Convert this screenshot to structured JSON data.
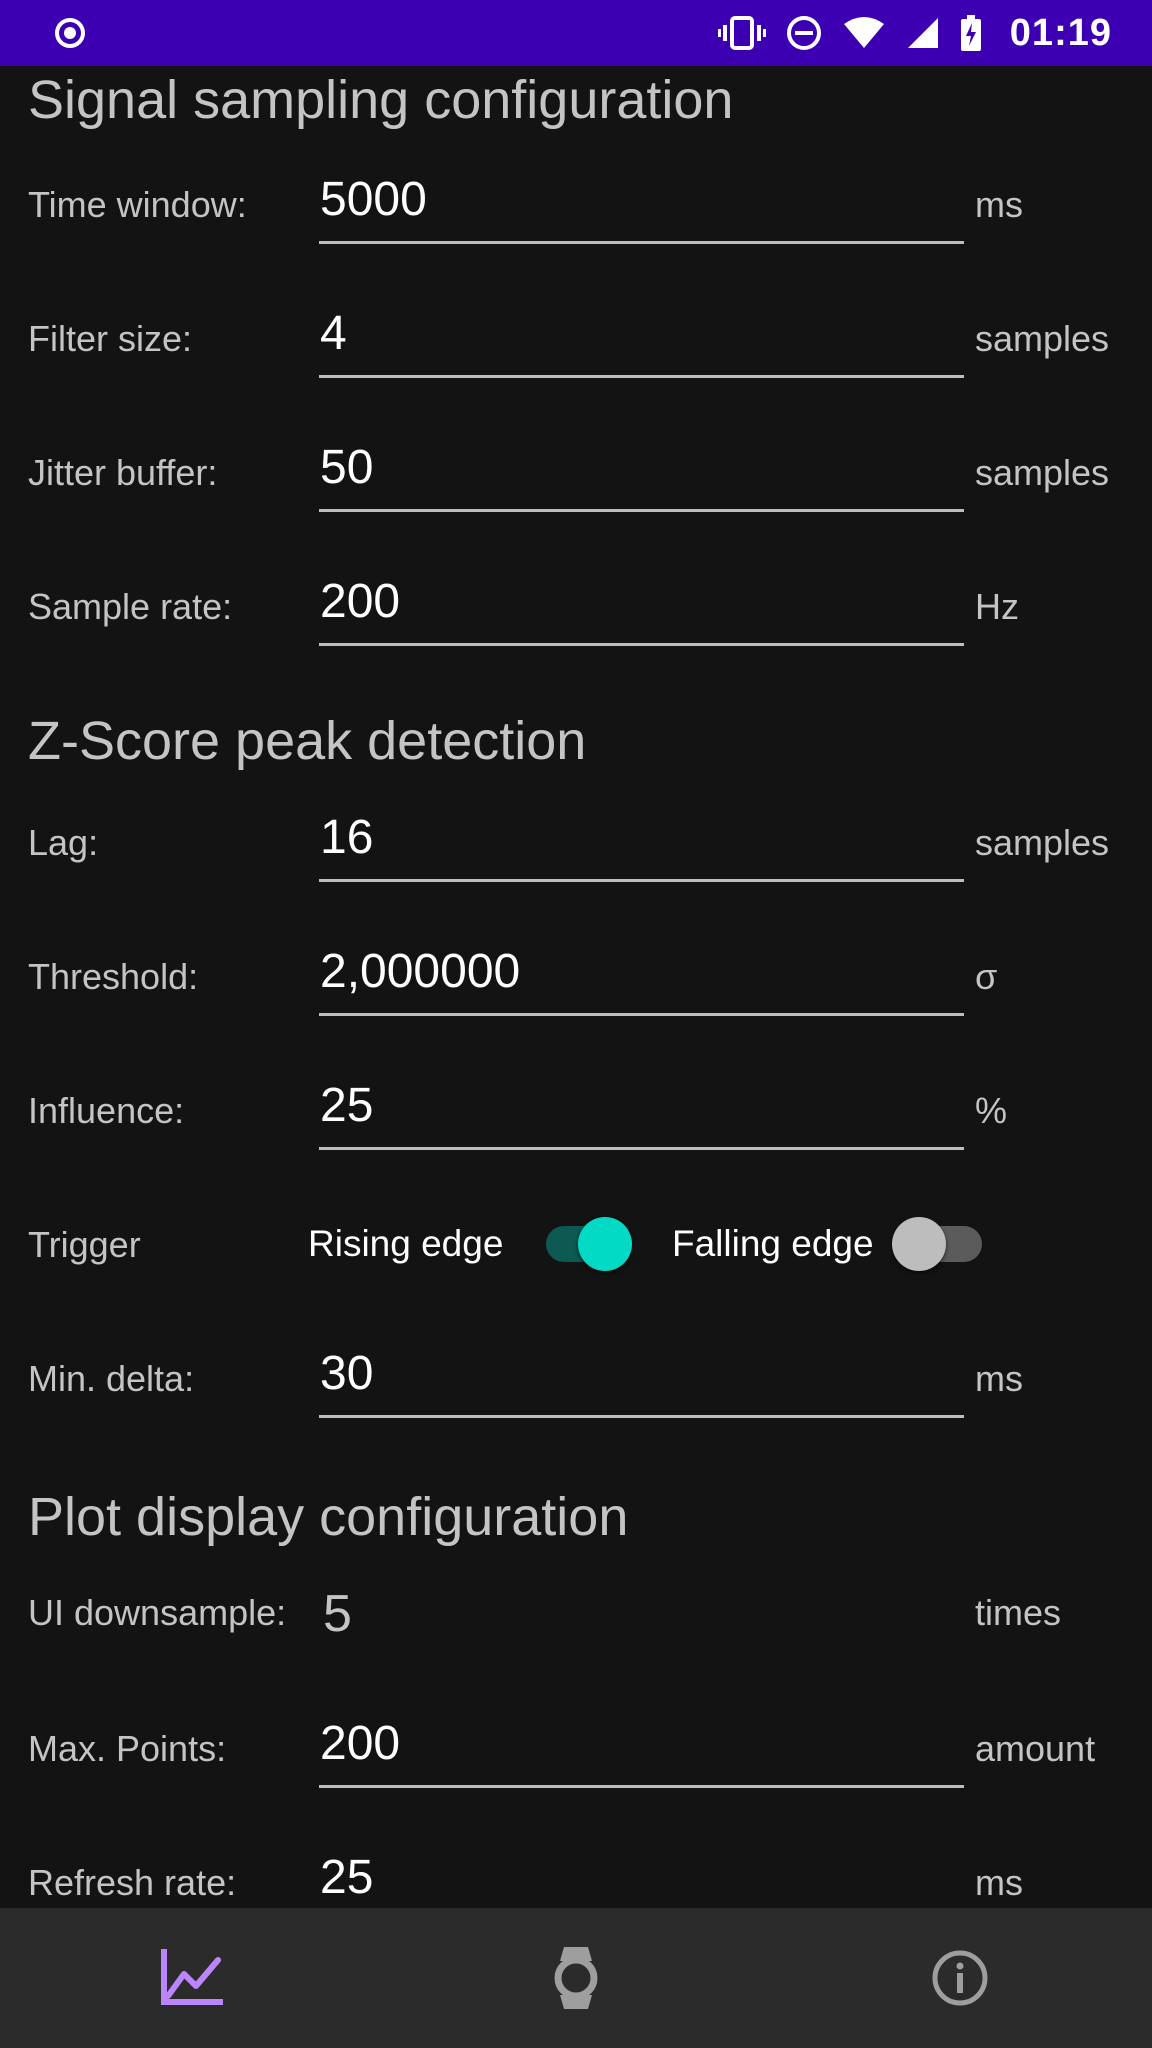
{
  "status_bar": {
    "time": "01:19",
    "icons": [
      "record-icon",
      "vibrate-icon",
      "do-not-disturb-icon",
      "wifi-icon",
      "signal-icon",
      "battery-charging-icon"
    ]
  },
  "signal_section": {
    "title": "Signal sampling configuration",
    "rows": [
      {
        "label": "Time window:",
        "value": "5000",
        "unit": "ms"
      },
      {
        "label": "Filter size:",
        "value": "4",
        "unit": "samples"
      },
      {
        "label": "Jitter buffer:",
        "value": "50",
        "unit": "samples"
      },
      {
        "label": "Sample rate:",
        "value": "200",
        "unit": "Hz"
      }
    ]
  },
  "zscore_section": {
    "title": "Z-Score peak detection",
    "rows": [
      {
        "label": "Lag:",
        "value": "16",
        "unit": "samples"
      },
      {
        "label": "Threshold:",
        "value": "2,000000",
        "unit": "σ"
      },
      {
        "label": "Influence:",
        "value": "25",
        "unit": "%"
      }
    ],
    "trigger": {
      "label": "Trigger",
      "rising_label": "Rising edge",
      "rising_on": true,
      "falling_label": "Falling edge",
      "falling_on": false
    },
    "min_delta": {
      "label": "Min. delta:",
      "value": "30",
      "unit": "ms"
    }
  },
  "plot_section": {
    "title": "Plot display configuration",
    "ui_downsample": {
      "label": "UI downsample:",
      "value": "5",
      "unit": "times"
    },
    "rows": [
      {
        "label": "Max. Points:",
        "value": "200",
        "unit": "amount"
      },
      {
        "label": "Refresh rate:",
        "value": "25",
        "unit": "ms"
      }
    ]
  },
  "bottom_nav": {
    "items": [
      {
        "icon": "chart-icon",
        "active": true
      },
      {
        "icon": "watch-icon",
        "active": false
      },
      {
        "icon": "info-icon",
        "active": false
      }
    ]
  },
  "colors": {
    "status_bar": "#3c00b2",
    "background": "#131313",
    "accent_switch": "#03dac5",
    "nav_active": "#bb86fc",
    "nav_inactive": "#9e9e9e"
  }
}
